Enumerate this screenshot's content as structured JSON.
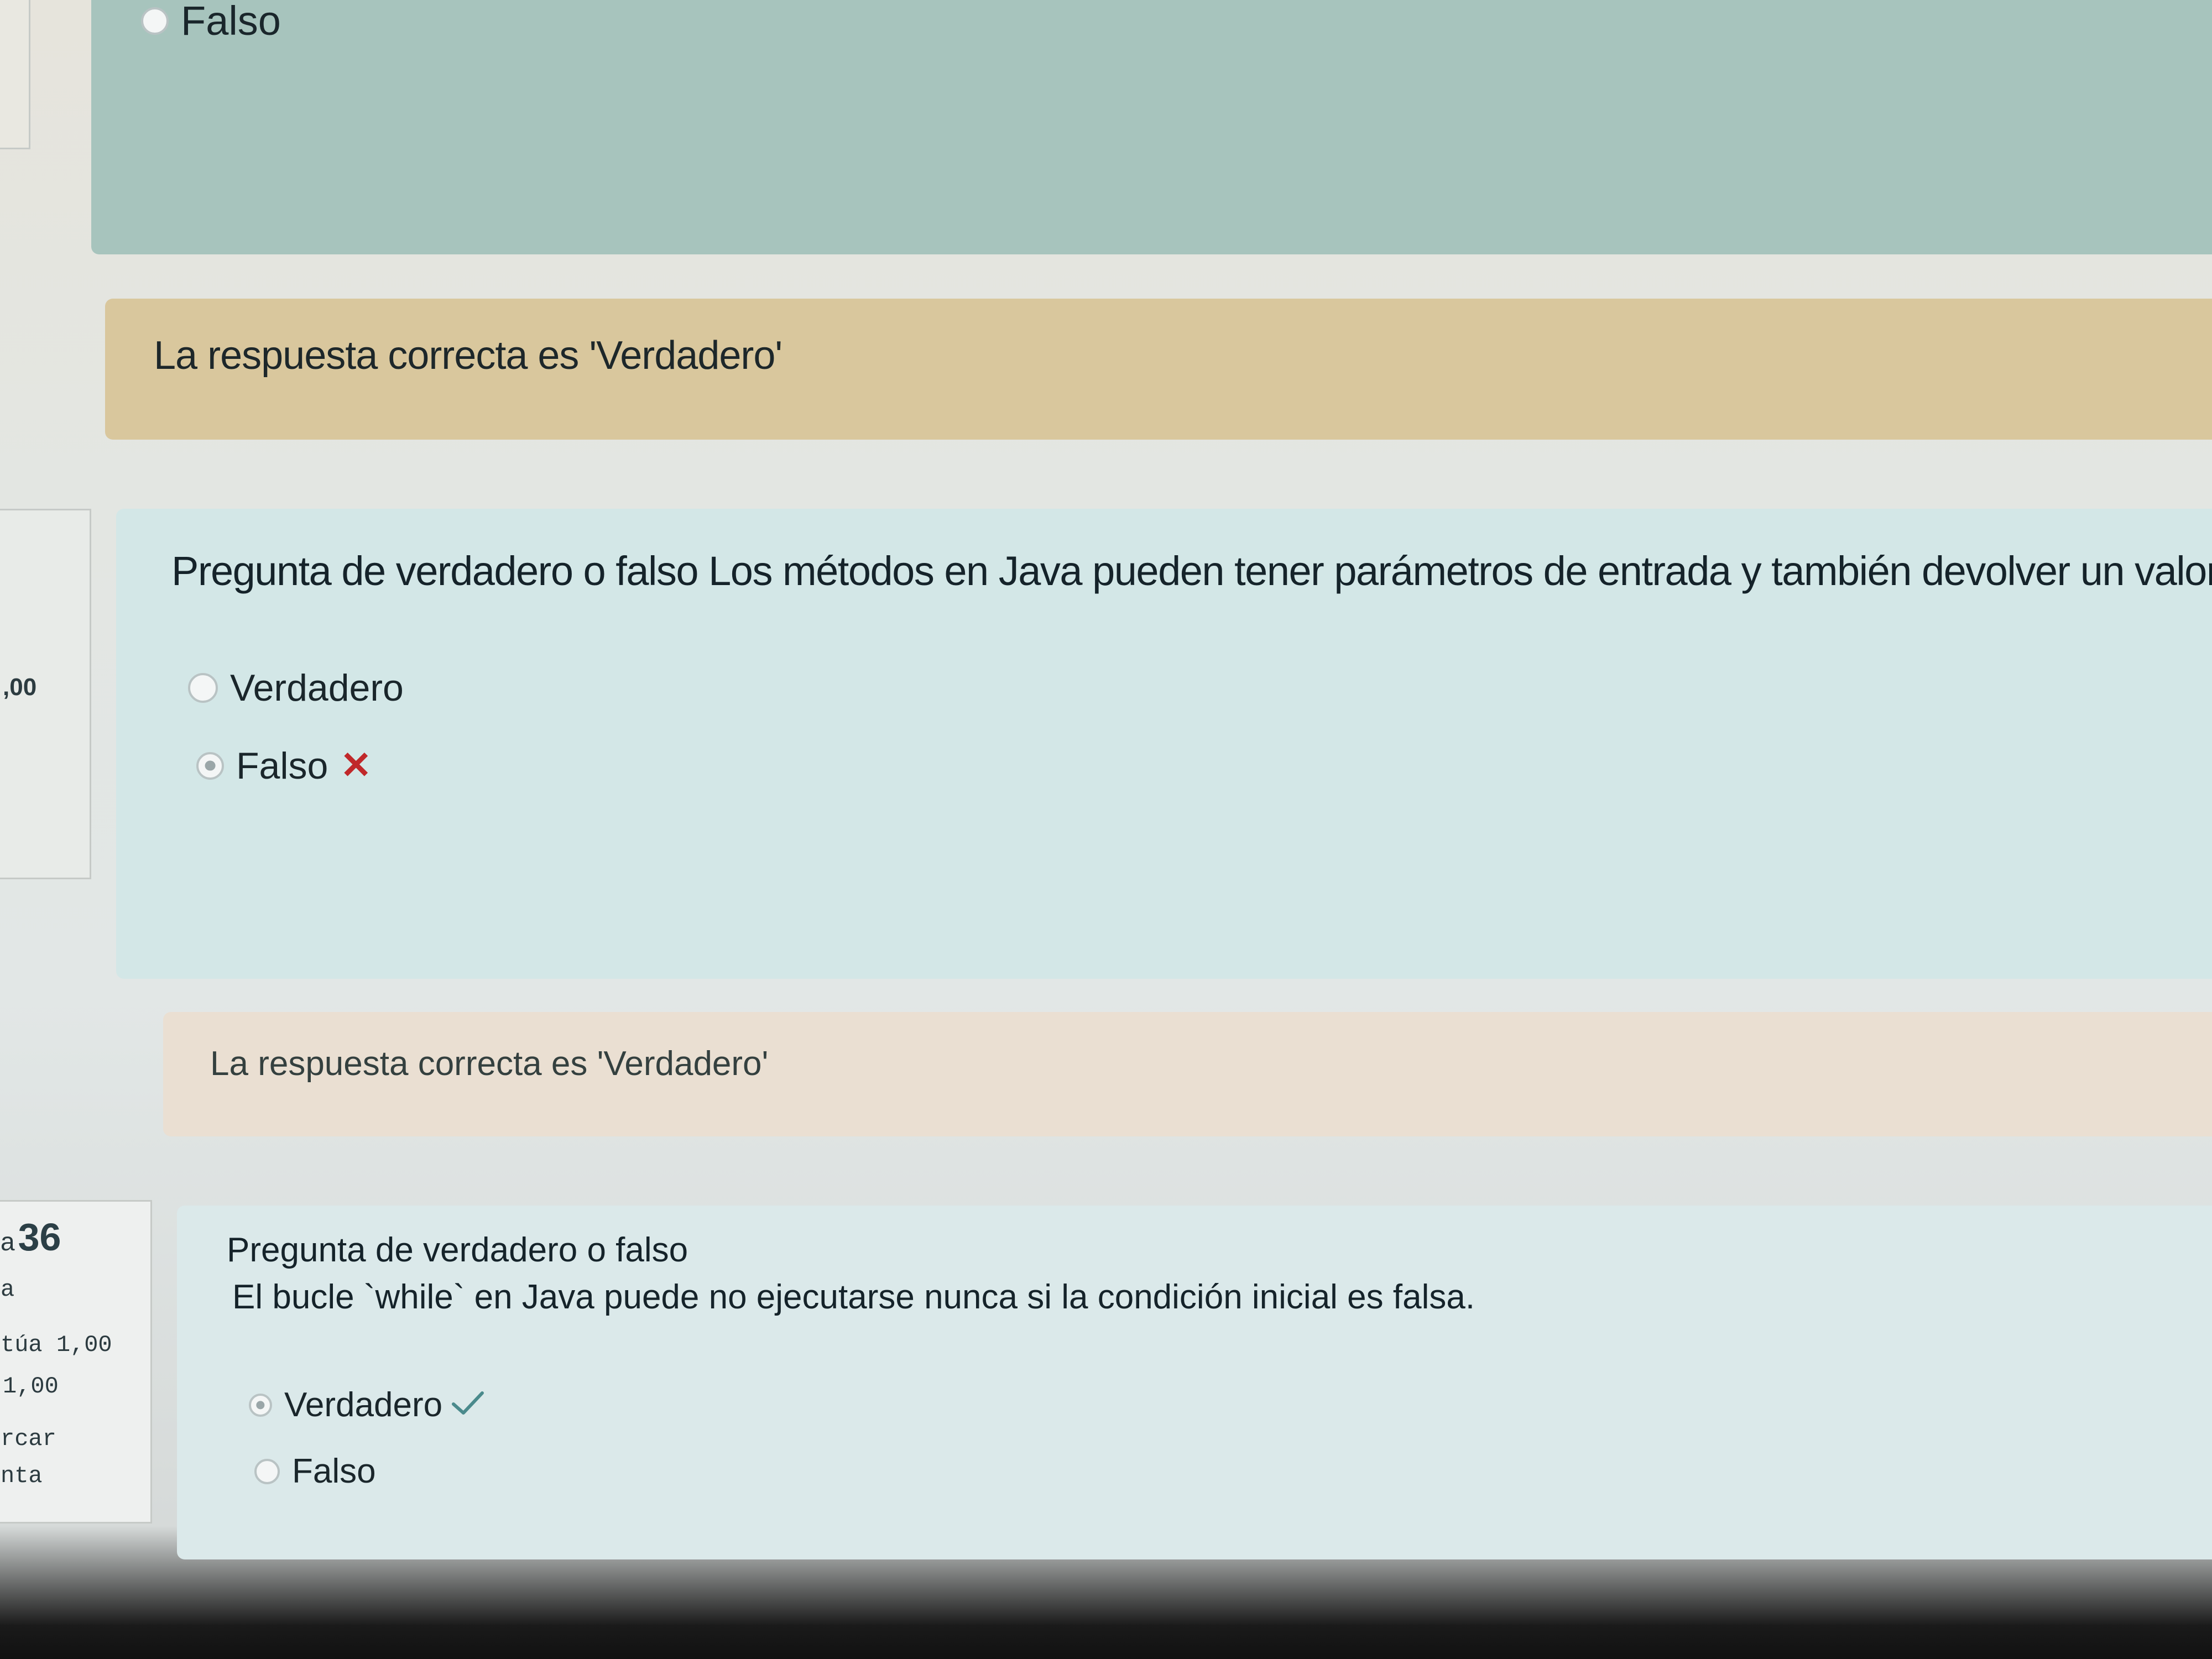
{
  "top_question": {
    "answers": [
      {
        "label": "Falso",
        "selected": false
      }
    ]
  },
  "feedback_1": {
    "text": "La respuesta correcta es 'Verdadero'"
  },
  "question_2": {
    "info": {
      "mark": ",00"
    },
    "text": "Pregunta de verdadero o falso Los métodos en Java pueden tener parámetros de entrada y también devolver un valor.",
    "answers": [
      {
        "label": "Verdadero",
        "selected": false,
        "mark": ""
      },
      {
        "label": "Falso",
        "selected": true,
        "mark": "✕"
      }
    ]
  },
  "feedback_2": {
    "text": "La respuesta correcta es 'Verdadero'"
  },
  "question_3": {
    "info": {
      "prefix": "a",
      "number": "36",
      "status": "a",
      "score_line": "túa 1,00",
      "max_line": "1,00",
      "flag_line_1": "rcar",
      "flag_line_2": "nta"
    },
    "text_a": "Pregunta de verdadero o falso",
    "text_b": "El bucle `while` en Java puede no ejecutarse nunca si la condición inicial es falsa.",
    "answers": [
      {
        "label": "Verdadero",
        "selected": true,
        "mark": "✓"
      },
      {
        "label": "Falso",
        "selected": false,
        "mark": ""
      }
    ]
  },
  "colors": {
    "wrong_mark": "#c0282a",
    "right_mark": "#4a8a8c",
    "question_bg": "#d3e7e7",
    "feedback_bg": "#d9c79d"
  }
}
